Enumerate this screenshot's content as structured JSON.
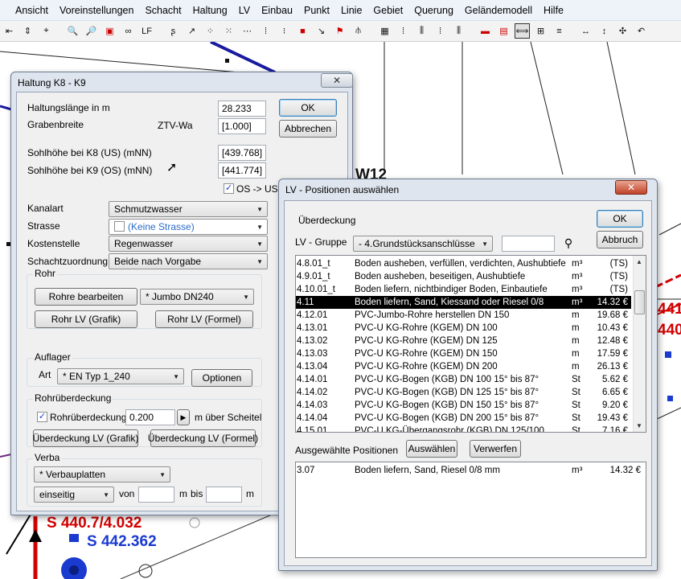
{
  "menubar": [
    "Ansicht",
    "Voreinstellungen",
    "Schacht",
    "Haltung",
    "LV",
    "Einbau",
    "Punkt",
    "Linie",
    "Gebiet",
    "Querung",
    "Geländemodell",
    "Hilfe"
  ],
  "toolbar": {
    "icons": [
      "insert-icon",
      "move-updown-icon",
      "pick-icon",
      "zoom-out-icon",
      "zoom-in-icon",
      "zoom-window-icon",
      "view-icon",
      "lf-icon",
      "sigma-icon",
      "arrow-icon",
      "select-icon",
      "select-area-icon",
      "grid-icon",
      "grid2-icon",
      "grid3-icon",
      "shaft-red-icon",
      "arrow2-icon",
      "flag-red-icon",
      "fork-icon",
      "tool1-icon",
      "tool2-icon",
      "tool3-icon",
      "tool4-icon",
      "tool5-icon",
      "minus-red-icon",
      "page-red-icon",
      "arrow-box-icon",
      "fb-icon",
      "stack-icon",
      "horizontal-arrows-icon",
      "vertical-arrows-icon",
      "crosshair-icon",
      "undo-icon"
    ],
    "lf_label": "LF"
  },
  "drawing": {
    "texts": {
      "label_w12": "W12",
      "label_441": "441",
      "label_440": "440",
      "label_s1": "S 440.7/4.032",
      "label_s2": "S 442.362"
    }
  },
  "haltung": {
    "title": "Haltung K8 - K9",
    "close": "✕",
    "labels": {
      "length": "Haltungslänge in m",
      "graben": "Grabenbreite",
      "ztv": "ZTV-Wa",
      "sohle_us": "Sohlhöhe bei K8 (US) (mNN)",
      "sohle_os": "Sohlhöhe bei K9 (OS) (mNN)",
      "os_us": "OS -> US",
      "kanalart": "Kanalart",
      "strasse": "Strasse",
      "kostenstelle": "Kostenstelle",
      "schacht": "Schachtzuordnung"
    },
    "values": {
      "length": "28.233",
      "graben": "[1.000]",
      "sohle_us": "[439.768]",
      "sohle_os": "[441.774]"
    },
    "buttons": {
      "ok": "OK",
      "cancel": "Abbrechen"
    },
    "combos": {
      "kanalart": "Schmutzwasser",
      "strasse": "(Keine Strasse)",
      "kostenstelle": "Regenwasser",
      "schacht": "Beide nach Vorgabe"
    },
    "rohr": {
      "title": "Rohr",
      "edit": "Rohre bearbeiten",
      "type": "* Jumbo DN240",
      "lv_grafik": "Rohr LV (Grafik)",
      "lv_formel": "Rohr LV (Formel)"
    },
    "auflager": {
      "title": "Auflager",
      "art_label": "Art",
      "art": "* EN Typ 1_240",
      "options": "Optionen"
    },
    "ueberdeckung": {
      "title": "Rohrüberdeckung",
      "check_label": "Rohrüberdeckung",
      "value": "0.200",
      "suffix": "m über Scheitel",
      "lv_grafik": "Überdeckung LV (Grafik)",
      "lv_formel": "Überdeckung LV (Formel)"
    },
    "verbau": {
      "title": "Verba",
      "type": "* Verbauplatten",
      "side": "einseitig",
      "von": "von",
      "m": "m",
      "bis": "bis",
      "m2": "m"
    }
  },
  "lv": {
    "title": "LV - Positionen auswählen",
    "close": "✕",
    "heading": "Überdeckung",
    "gruppe_label": "LV - Gruppe",
    "gruppe": "- 4.Grundstücksanschlüsse",
    "ok": "OK",
    "abbruch": "Abbruch",
    "rows": [
      {
        "code": "4.8.01_t",
        "desc": "Boden ausheben, verfüllen, verdichten, Aushubtiefe",
        "unit": "m³",
        "price": "(TS)"
      },
      {
        "code": "4.9.01_t",
        "desc": "Boden ausheben, beseitigen, Aushubtiefe",
        "unit": "m³",
        "price": "(TS)"
      },
      {
        "code": "4.10.01_t",
        "desc": "Boden liefern, nichtbindiger Boden, Einbautiefe",
        "unit": "m³",
        "price": "(TS)"
      },
      {
        "code": "4.11",
        "desc": "Boden liefern, Sand, Kiessand oder Riesel 0/8",
        "unit": "m³",
        "price": "14.32 €"
      },
      {
        "code": "4.12.01",
        "desc": "PVC-Jumbo-Rohre herstellen DN 150",
        "unit": "m",
        "price": "19.68 €"
      },
      {
        "code": "4.13.01",
        "desc": "PVC-U KG-Rohre (KGEM) DN 100",
        "unit": "m",
        "price": "10.43 €"
      },
      {
        "code": "4.13.02",
        "desc": "PVC-U KG-Rohre (KGEM) DN 125",
        "unit": "m",
        "price": "12.48 €"
      },
      {
        "code": "4.13.03",
        "desc": "PVC-U KG-Rohre (KGEM) DN 150",
        "unit": "m",
        "price": "17.59 €"
      },
      {
        "code": "4.13.04",
        "desc": "PVC-U KG-Rohre (KGEM) DN 200",
        "unit": "m",
        "price": "26.13 €"
      },
      {
        "code": "4.14.01",
        "desc": "PVC-U KG-Bogen (KGB) DN 100 15° bis 87°",
        "unit": "St",
        "price": "5.62 €"
      },
      {
        "code": "4.14.02",
        "desc": "PVC-U KG-Bogen (KGB) DN 125 15° bis 87°",
        "unit": "St",
        "price": "6.65 €"
      },
      {
        "code": "4.14.03",
        "desc": "PVC-U KG-Bogen (KGB) DN 150 15° bis 87°",
        "unit": "St",
        "price": "9.20 €"
      },
      {
        "code": "4.14.04",
        "desc": "PVC-U KG-Bogen (KGB) DN 200 15° bis 87°",
        "unit": "St",
        "price": "19.43 €"
      },
      {
        "code": "4.15.01",
        "desc": "PVC-U KG-Übergangsrohr (KGB) DN 125/100",
        "unit": "St",
        "price": "7.16 €"
      }
    ],
    "selected_index": 3,
    "ausgewaehlt_label": "Ausgewählte Positionen",
    "auswaehlen": "Auswählen",
    "verwerfen": "Verwerfen",
    "selected_rows": [
      {
        "code": "3.07",
        "desc": "Boden liefern, Sand, Riesel 0/8 mm",
        "unit": "m³",
        "price": "14.32 €"
      }
    ]
  }
}
